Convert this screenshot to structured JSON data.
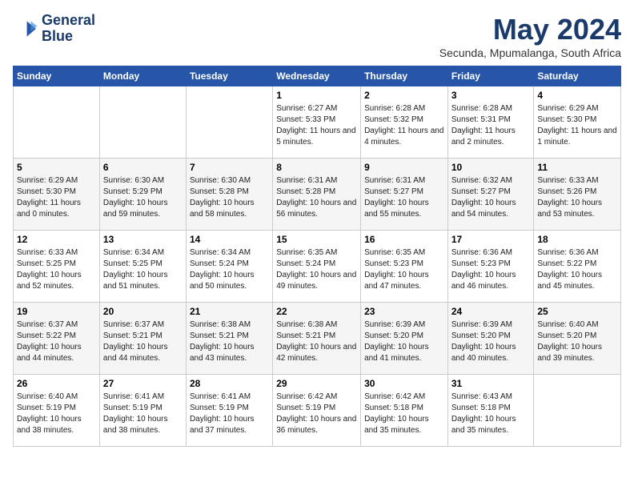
{
  "header": {
    "logo_line1": "General",
    "logo_line2": "Blue",
    "month_title": "May 2024",
    "subtitle": "Secunda, Mpumalanga, South Africa"
  },
  "days_of_week": [
    "Sunday",
    "Monday",
    "Tuesday",
    "Wednesday",
    "Thursday",
    "Friday",
    "Saturday"
  ],
  "weeks": [
    [
      {
        "day": "",
        "info": ""
      },
      {
        "day": "",
        "info": ""
      },
      {
        "day": "",
        "info": ""
      },
      {
        "day": "1",
        "info": "Sunrise: 6:27 AM\nSunset: 5:33 PM\nDaylight: 11 hours and 5 minutes."
      },
      {
        "day": "2",
        "info": "Sunrise: 6:28 AM\nSunset: 5:32 PM\nDaylight: 11 hours and 4 minutes."
      },
      {
        "day": "3",
        "info": "Sunrise: 6:28 AM\nSunset: 5:31 PM\nDaylight: 11 hours and 2 minutes."
      },
      {
        "day": "4",
        "info": "Sunrise: 6:29 AM\nSunset: 5:30 PM\nDaylight: 11 hours and 1 minute."
      }
    ],
    [
      {
        "day": "5",
        "info": "Sunrise: 6:29 AM\nSunset: 5:30 PM\nDaylight: 11 hours and 0 minutes."
      },
      {
        "day": "6",
        "info": "Sunrise: 6:30 AM\nSunset: 5:29 PM\nDaylight: 10 hours and 59 minutes."
      },
      {
        "day": "7",
        "info": "Sunrise: 6:30 AM\nSunset: 5:28 PM\nDaylight: 10 hours and 58 minutes."
      },
      {
        "day": "8",
        "info": "Sunrise: 6:31 AM\nSunset: 5:28 PM\nDaylight: 10 hours and 56 minutes."
      },
      {
        "day": "9",
        "info": "Sunrise: 6:31 AM\nSunset: 5:27 PM\nDaylight: 10 hours and 55 minutes."
      },
      {
        "day": "10",
        "info": "Sunrise: 6:32 AM\nSunset: 5:27 PM\nDaylight: 10 hours and 54 minutes."
      },
      {
        "day": "11",
        "info": "Sunrise: 6:33 AM\nSunset: 5:26 PM\nDaylight: 10 hours and 53 minutes."
      }
    ],
    [
      {
        "day": "12",
        "info": "Sunrise: 6:33 AM\nSunset: 5:25 PM\nDaylight: 10 hours and 52 minutes."
      },
      {
        "day": "13",
        "info": "Sunrise: 6:34 AM\nSunset: 5:25 PM\nDaylight: 10 hours and 51 minutes."
      },
      {
        "day": "14",
        "info": "Sunrise: 6:34 AM\nSunset: 5:24 PM\nDaylight: 10 hours and 50 minutes."
      },
      {
        "day": "15",
        "info": "Sunrise: 6:35 AM\nSunset: 5:24 PM\nDaylight: 10 hours and 49 minutes."
      },
      {
        "day": "16",
        "info": "Sunrise: 6:35 AM\nSunset: 5:23 PM\nDaylight: 10 hours and 47 minutes."
      },
      {
        "day": "17",
        "info": "Sunrise: 6:36 AM\nSunset: 5:23 PM\nDaylight: 10 hours and 46 minutes."
      },
      {
        "day": "18",
        "info": "Sunrise: 6:36 AM\nSunset: 5:22 PM\nDaylight: 10 hours and 45 minutes."
      }
    ],
    [
      {
        "day": "19",
        "info": "Sunrise: 6:37 AM\nSunset: 5:22 PM\nDaylight: 10 hours and 44 minutes."
      },
      {
        "day": "20",
        "info": "Sunrise: 6:37 AM\nSunset: 5:21 PM\nDaylight: 10 hours and 44 minutes."
      },
      {
        "day": "21",
        "info": "Sunrise: 6:38 AM\nSunset: 5:21 PM\nDaylight: 10 hours and 43 minutes."
      },
      {
        "day": "22",
        "info": "Sunrise: 6:38 AM\nSunset: 5:21 PM\nDaylight: 10 hours and 42 minutes."
      },
      {
        "day": "23",
        "info": "Sunrise: 6:39 AM\nSunset: 5:20 PM\nDaylight: 10 hours and 41 minutes."
      },
      {
        "day": "24",
        "info": "Sunrise: 6:39 AM\nSunset: 5:20 PM\nDaylight: 10 hours and 40 minutes."
      },
      {
        "day": "25",
        "info": "Sunrise: 6:40 AM\nSunset: 5:20 PM\nDaylight: 10 hours and 39 minutes."
      }
    ],
    [
      {
        "day": "26",
        "info": "Sunrise: 6:40 AM\nSunset: 5:19 PM\nDaylight: 10 hours and 38 minutes."
      },
      {
        "day": "27",
        "info": "Sunrise: 6:41 AM\nSunset: 5:19 PM\nDaylight: 10 hours and 38 minutes."
      },
      {
        "day": "28",
        "info": "Sunrise: 6:41 AM\nSunset: 5:19 PM\nDaylight: 10 hours and 37 minutes."
      },
      {
        "day": "29",
        "info": "Sunrise: 6:42 AM\nSunset: 5:19 PM\nDaylight: 10 hours and 36 minutes."
      },
      {
        "day": "30",
        "info": "Sunrise: 6:42 AM\nSunset: 5:18 PM\nDaylight: 10 hours and 35 minutes."
      },
      {
        "day": "31",
        "info": "Sunrise: 6:43 AM\nSunset: 5:18 PM\nDaylight: 10 hours and 35 minutes."
      },
      {
        "day": "",
        "info": ""
      }
    ]
  ]
}
